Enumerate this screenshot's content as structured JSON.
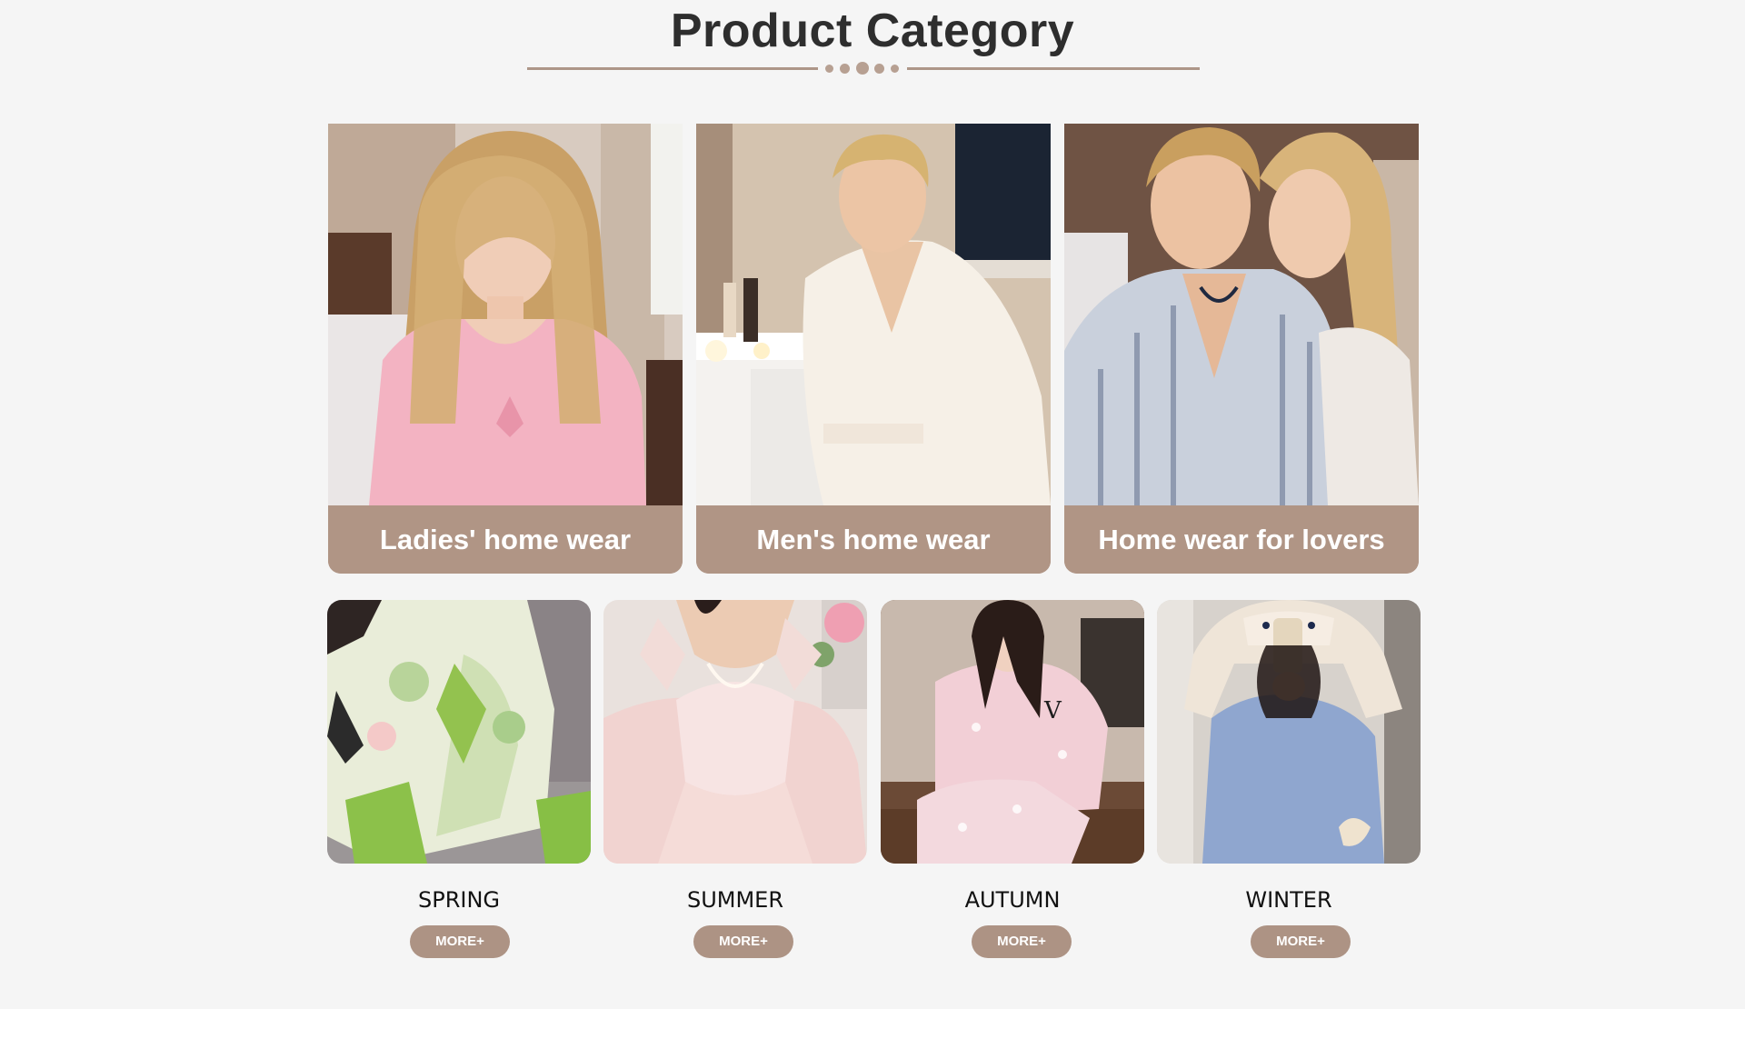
{
  "header": {
    "title": "Product Category",
    "accent_color": "#ad9688"
  },
  "categories": [
    {
      "label": "Ladies' home wear",
      "image": "woman-in-pink-nightgown"
    },
    {
      "label": "Men's home wear",
      "image": "man-in-white-satin-robe"
    },
    {
      "label": "Home wear for lovers",
      "image": "couple-in-striped-pajamas"
    }
  ],
  "seasons": [
    {
      "label": "SPRING",
      "button": "MORE+",
      "image": "green-floral-satin-pajamas"
    },
    {
      "label": "SUMMER",
      "button": "MORE+",
      "image": "pink-lace-slip-dress"
    },
    {
      "label": "AUTUMN",
      "button": "MORE+",
      "image": "pink-leopard-velvet-pajamas"
    },
    {
      "label": "WINTER",
      "button": "MORE+",
      "image": "blue-fleece-bunny-hoodie"
    }
  ],
  "colors": {
    "card_caption_bg": "#b09585",
    "button_bg": "#ad9384",
    "page_bg": "#f5f5f5"
  }
}
